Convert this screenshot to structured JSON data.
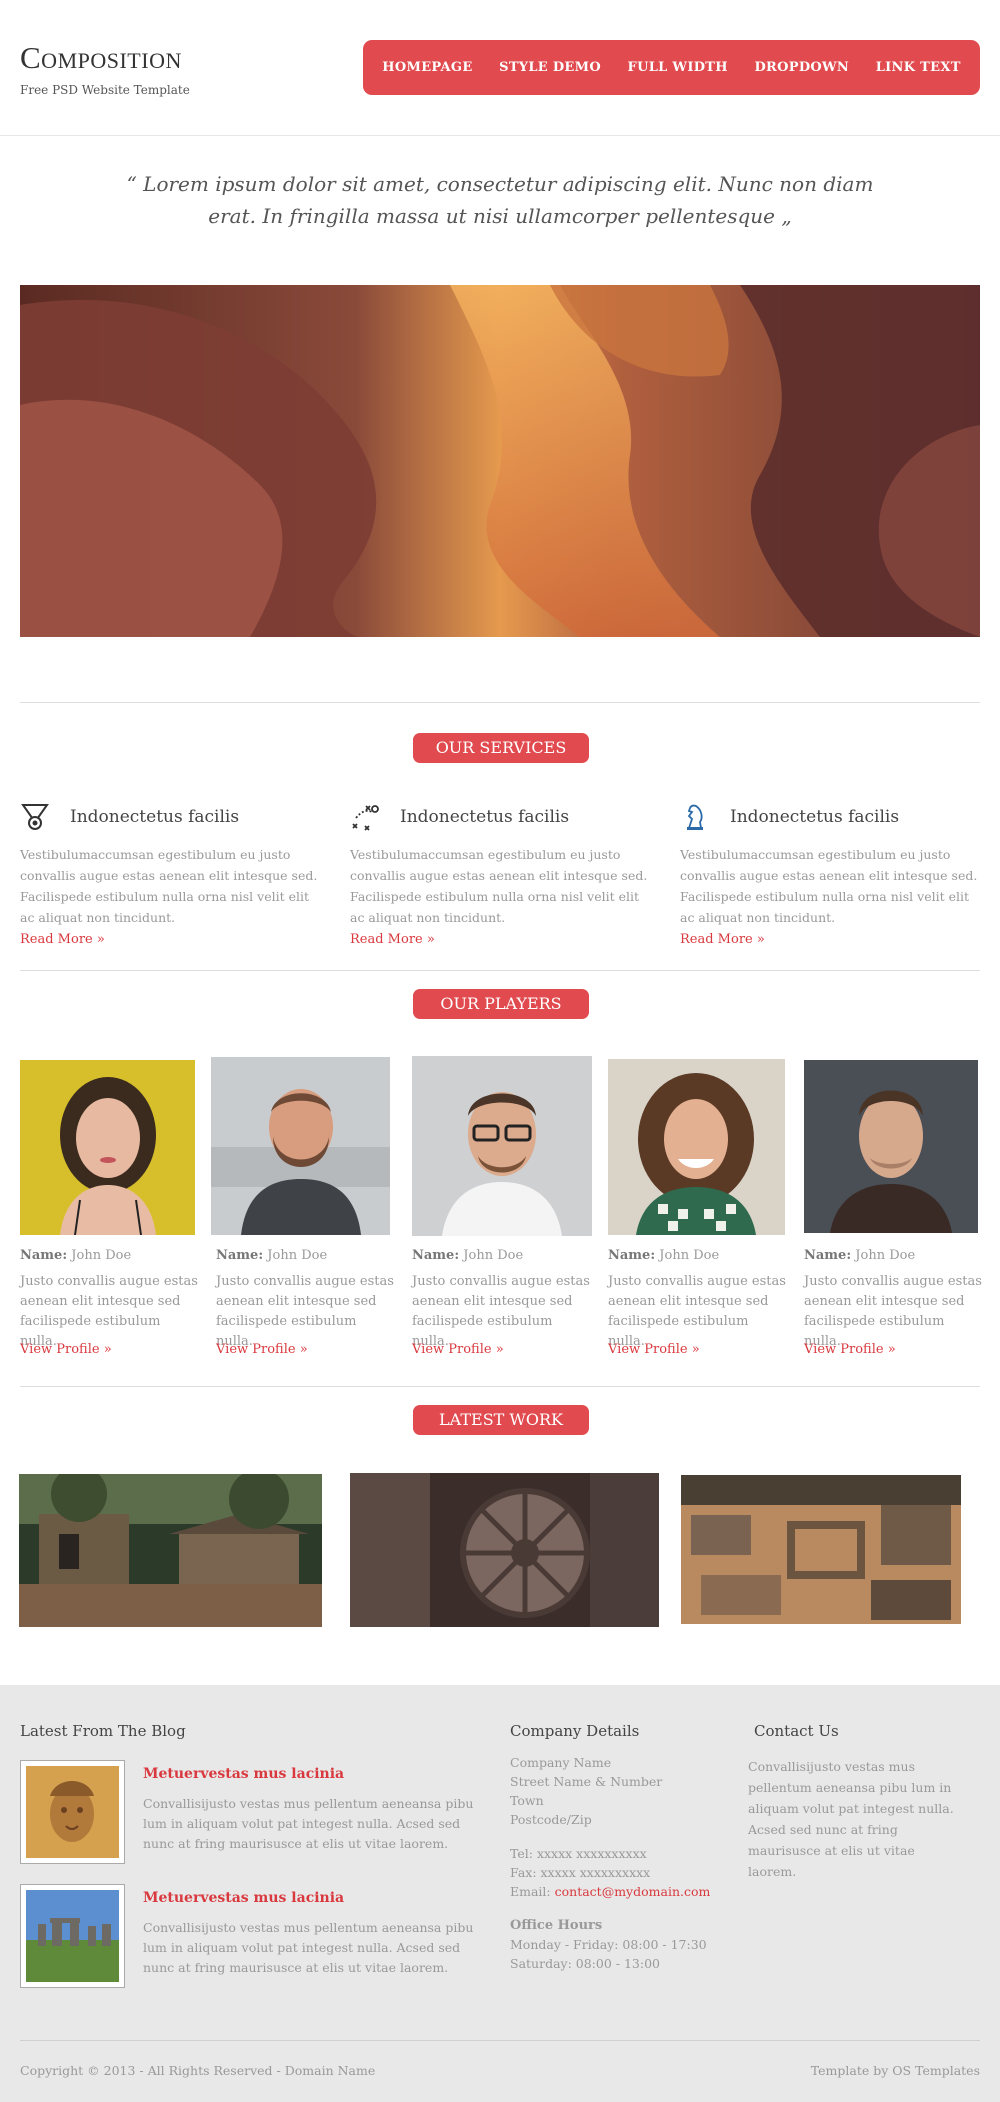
{
  "header": {
    "logo_title": "Composition",
    "logo_subtitle": "Free PSD Website Template",
    "nav": [
      "HOMEPAGE",
      "STYLE DEMO",
      "FULL WIDTH",
      "DROPDOWN",
      "LINK TEXT"
    ]
  },
  "quote": "“ Lorem ipsum dolor sit amet, consectetur adipiscing elit. Nunc non diam erat. In fringilla massa ut nisi ullamcorper pellentesque „",
  "services": {
    "heading": "OUR SERVICES",
    "items": [
      {
        "icon": "medal-icon",
        "title": "Indonectetus facilis",
        "text": "Vestibulumaccumsan egestibulum eu justo convallis augue estas aenean elit intesque sed. Facilispede estibulum nulla orna nisl velit elit ac aliquat non tincidunt.",
        "more": "Read More »"
      },
      {
        "icon": "strategy-icon",
        "title": "Indonectetus facilis",
        "text": "Vestibulumaccumsan egestibulum eu justo convallis augue estas aenean elit intesque sed. Facilispede estibulum nulla orna nisl velit elit ac aliquat non tincidunt.",
        "more": "Read More »"
      },
      {
        "icon": "chess-knight-icon",
        "title": "Indonectetus facilis",
        "text": "Vestibulumaccumsan egestibulum eu justo convallis augue estas aenean elit intesque sed. Facilispede estibulum nulla orna nisl velit elit ac aliquat non tincidunt.",
        "more": "Read More »"
      }
    ]
  },
  "players": {
    "heading": "OUR PLAYERS",
    "name_label": "Name:",
    "items": [
      {
        "name": "John Doe",
        "text": "Justo convallis augue estas aenean elit intesque sed facilispede estibulum nulla.",
        "more": "View Profile »"
      },
      {
        "name": "John Doe",
        "text": "Justo convallis augue estas aenean elit intesque sed facilispede estibulum nulla.",
        "more": "View Profile »"
      },
      {
        "name": "John Doe",
        "text": "Justo convallis augue estas aenean elit intesque sed facilispede estibulum nulla.",
        "more": "View Profile »"
      },
      {
        "name": "John Doe",
        "text": "Justo convallis augue estas aenean elit intesque sed facilispede estibulum nulla.",
        "more": "View Profile »"
      },
      {
        "name": "John Doe",
        "text": "Justo convallis augue estas aenean elit intesque sed facilispede estibulum nulla.",
        "more": "View Profile »"
      }
    ]
  },
  "work": {
    "heading": "LATEST WORK"
  },
  "footer": {
    "blog": {
      "heading": "Latest From The Blog",
      "posts": [
        {
          "title": "Metuervestas mus lacinia",
          "text": "Convallisijusto vestas mus pellentum aeneansa pibu lum in aliquam volut pat integest nulla. Acsed sed nunc at fring maurisusce at elis ut vitae laorem."
        },
        {
          "title": "Metuervestas mus lacinia",
          "text": "Convallisijusto vestas mus pellentum aeneansa pibu lum in aliquam volut pat integest nulla. Acsed sed nunc at fring maurisusce at elis ut vitae laorem."
        }
      ]
    },
    "company": {
      "heading": "Company Details",
      "address": [
        "Company Name",
        "Street Name & Number",
        "Town",
        "Postcode/Zip"
      ],
      "tel": "Tel: xxxxx xxxxxxxxxx",
      "fax": "Fax: xxxxx xxxxxxxxxx",
      "email_label": "Email:",
      "email": "contact@mydomain.com",
      "hours_heading": "Office Hours",
      "hours": [
        "Monday - Friday: 08:00 - 17:30",
        "Saturday: 08:00 - 13:00"
      ]
    },
    "contact": {
      "heading": "Contact Us",
      "text": "Convallisijusto vestas mus pellentum aeneansa pibu lum in aliquam volut pat integest nulla. Acsed sed nunc at fring maurisusce at elis ut vitae laorem."
    },
    "copyright": "Copyright © 2013 - All Rights Reserved - Domain Name",
    "credit": "Template by OS Templates"
  },
  "colors": {
    "accent": "#e14b50",
    "link": "#d9393e",
    "footer_bg": "#e8e8e8"
  }
}
